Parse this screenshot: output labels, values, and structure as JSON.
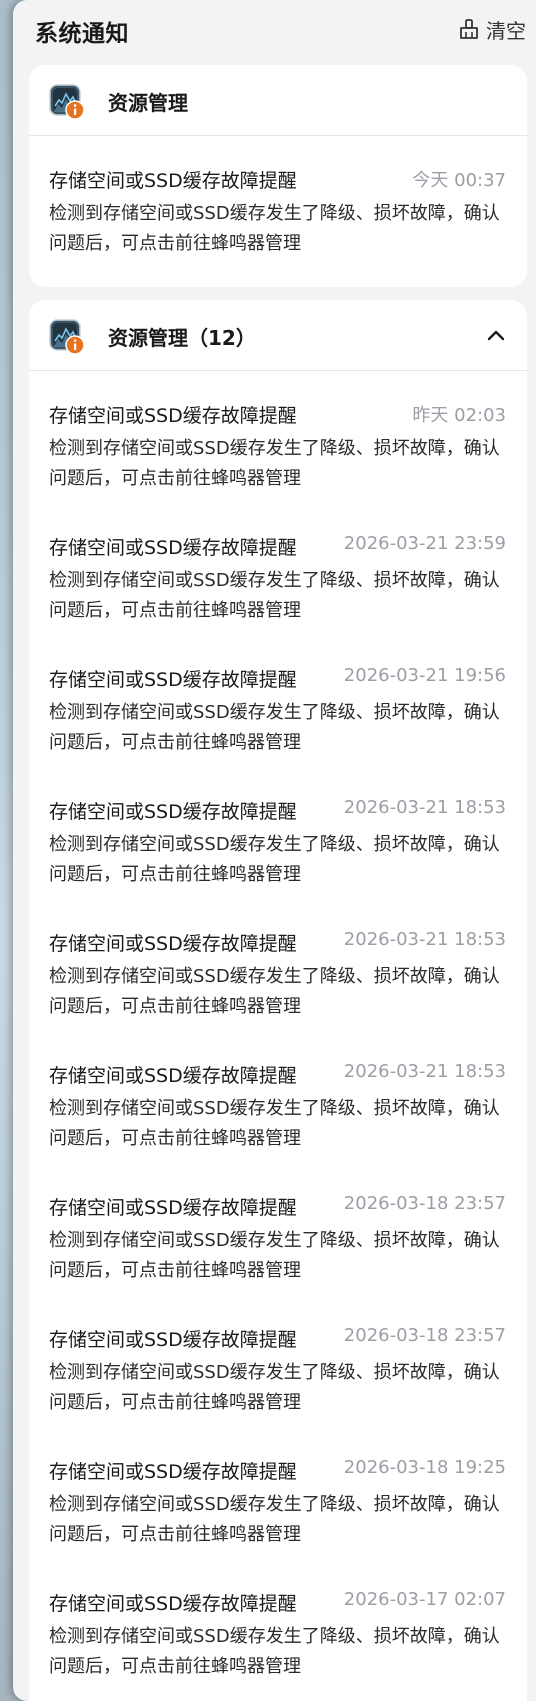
{
  "panel": {
    "title": "系统通知",
    "clear_label": "清空"
  },
  "groups": [
    {
      "title": "资源管理",
      "icon": "resource-monitor-icon",
      "notices": [
        {
          "title": "存储空间或SSD缓存故障提醒",
          "time": "今天 00:37",
          "body": "检测到存储空间或SSD缓存发生了降级、损坏故障，确认问题后，可点击前往蜂鸣器管理"
        }
      ]
    },
    {
      "title": "资源管理（12）",
      "icon": "resource-monitor-icon",
      "expanded": true,
      "notices": [
        {
          "title": "存储空间或SSD缓存故障提醒",
          "time": "昨天 02:03",
          "body": "检测到存储空间或SSD缓存发生了降级、损坏故障，确认问题后，可点击前往蜂鸣器管理"
        },
        {
          "title": "存储空间或SSD缓存故障提醒",
          "time": "2026-03-21 23:59",
          "body": "检测到存储空间或SSD缓存发生了降级、损坏故障，确认问题后，可点击前往蜂鸣器管理"
        },
        {
          "title": "存储空间或SSD缓存故障提醒",
          "time": "2026-03-21 19:56",
          "body": "检测到存储空间或SSD缓存发生了降级、损坏故障，确认问题后，可点击前往蜂鸣器管理"
        },
        {
          "title": "存储空间或SSD缓存故障提醒",
          "time": "2026-03-21 18:53",
          "body": "检测到存储空间或SSD缓存发生了降级、损坏故障，确认问题后，可点击前往蜂鸣器管理"
        },
        {
          "title": "存储空间或SSD缓存故障提醒",
          "time": "2026-03-21 18:53",
          "body": "检测到存储空间或SSD缓存发生了降级、损坏故障，确认问题后，可点击前往蜂鸣器管理"
        },
        {
          "title": "存储空间或SSD缓存故障提醒",
          "time": "2026-03-21 18:53",
          "body": "检测到存储空间或SSD缓存发生了降级、损坏故障，确认问题后，可点击前往蜂鸣器管理"
        },
        {
          "title": "存储空间或SSD缓存故障提醒",
          "time": "2026-03-18 23:57",
          "body": "检测到存储空间或SSD缓存发生了降级、损坏故障，确认问题后，可点击前往蜂鸣器管理"
        },
        {
          "title": "存储空间或SSD缓存故障提醒",
          "time": "2026-03-18 23:57",
          "body": "检测到存储空间或SSD缓存发生了降级、损坏故障，确认问题后，可点击前往蜂鸣器管理"
        },
        {
          "title": "存储空间或SSD缓存故障提醒",
          "time": "2026-03-18 19:25",
          "body": "检测到存储空间或SSD缓存发生了降级、损坏故障，确认问题后，可点击前往蜂鸣器管理"
        },
        {
          "title": "存储空间或SSD缓存故障提醒",
          "time": "2026-03-17 02:07",
          "body": "检测到存储空间或SSD缓存发生了降级、损坏故障，确认问题后，可点击前往蜂鸣器管理"
        }
      ]
    }
  ],
  "colors": {
    "panel_bg": "#f2f3f5",
    "card_bg": "#ffffff",
    "badge_orange": "#e8731f",
    "muted_text": "#9a9ea5"
  }
}
